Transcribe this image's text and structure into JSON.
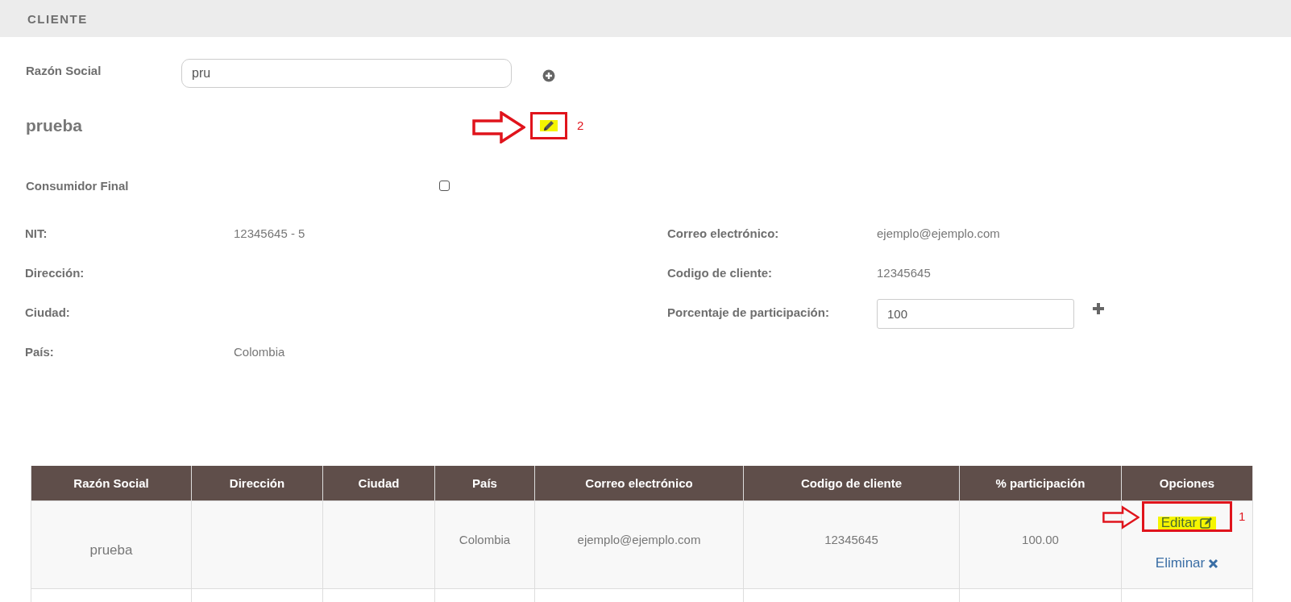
{
  "header": {
    "title": "CLIENTE"
  },
  "search": {
    "label": "Razón Social",
    "value": "pru"
  },
  "client": {
    "name": "prueba"
  },
  "consumer": {
    "label": "Consumidor Final",
    "checked": false
  },
  "fields_left": [
    {
      "label": "NIT:",
      "value": "12345645 - 5"
    },
    {
      "label": "Dirección:"
    },
    {
      "label": "Ciudad:"
    },
    {
      "label": "País:",
      "value": "Colombia"
    }
  ],
  "fields_right": [
    {
      "label": "Correo electrónico:",
      "value": "ejemplo@ejemplo.com",
      "kind": "text"
    },
    {
      "label": "Codigo de cliente:",
      "value": "12345645",
      "kind": "text"
    },
    {
      "label": "Porcentaje de participación:",
      "value": "100",
      "kind": "input"
    }
  ],
  "table": {
    "columns": [
      "Razón Social",
      "Dirección",
      "Ciudad",
      "País",
      "Correo electrónico",
      "Codigo de cliente",
      "% participación",
      "Opciones"
    ],
    "rows": [
      {
        "cells": [
          "prueba",
          "",
          "",
          "Colombia",
          "ejemplo@ejemplo.com",
          "12345645",
          "100.00"
        ],
        "options": [
          {
            "label": "Editar",
            "kind": "edit",
            "highlighted": true
          },
          {
            "label": "Eliminar",
            "kind": "delete",
            "highlighted": false
          }
        ]
      }
    ]
  },
  "annotations": [
    {
      "label": "2"
    },
    {
      "label": "1"
    }
  ]
}
